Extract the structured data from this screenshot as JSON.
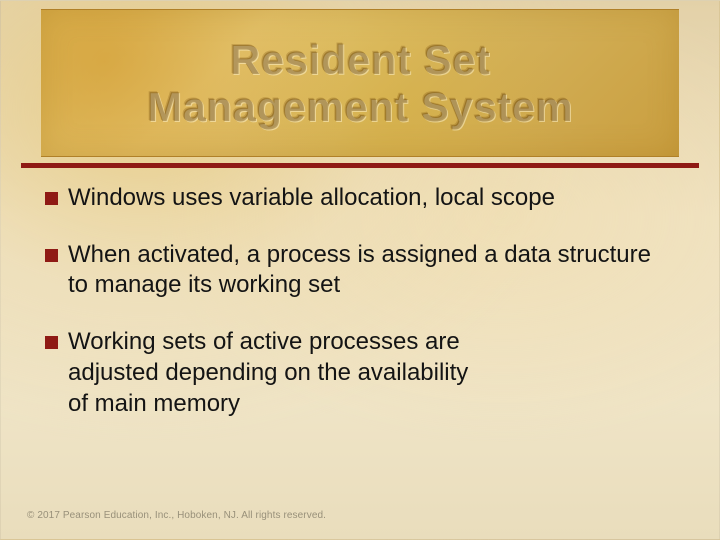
{
  "title_line1": "Resident Set",
  "title_line2": "Management System",
  "bullets": [
    "Windows uses variable allocation, local scope",
    "When activated, a process is assigned a data structure to manage its working set",
    "Working sets of active processes are adjusted depending on the availability of main memory"
  ],
  "footer": "© 2017 Pearson Education, Inc., Hoboken, NJ. All rights reserved."
}
